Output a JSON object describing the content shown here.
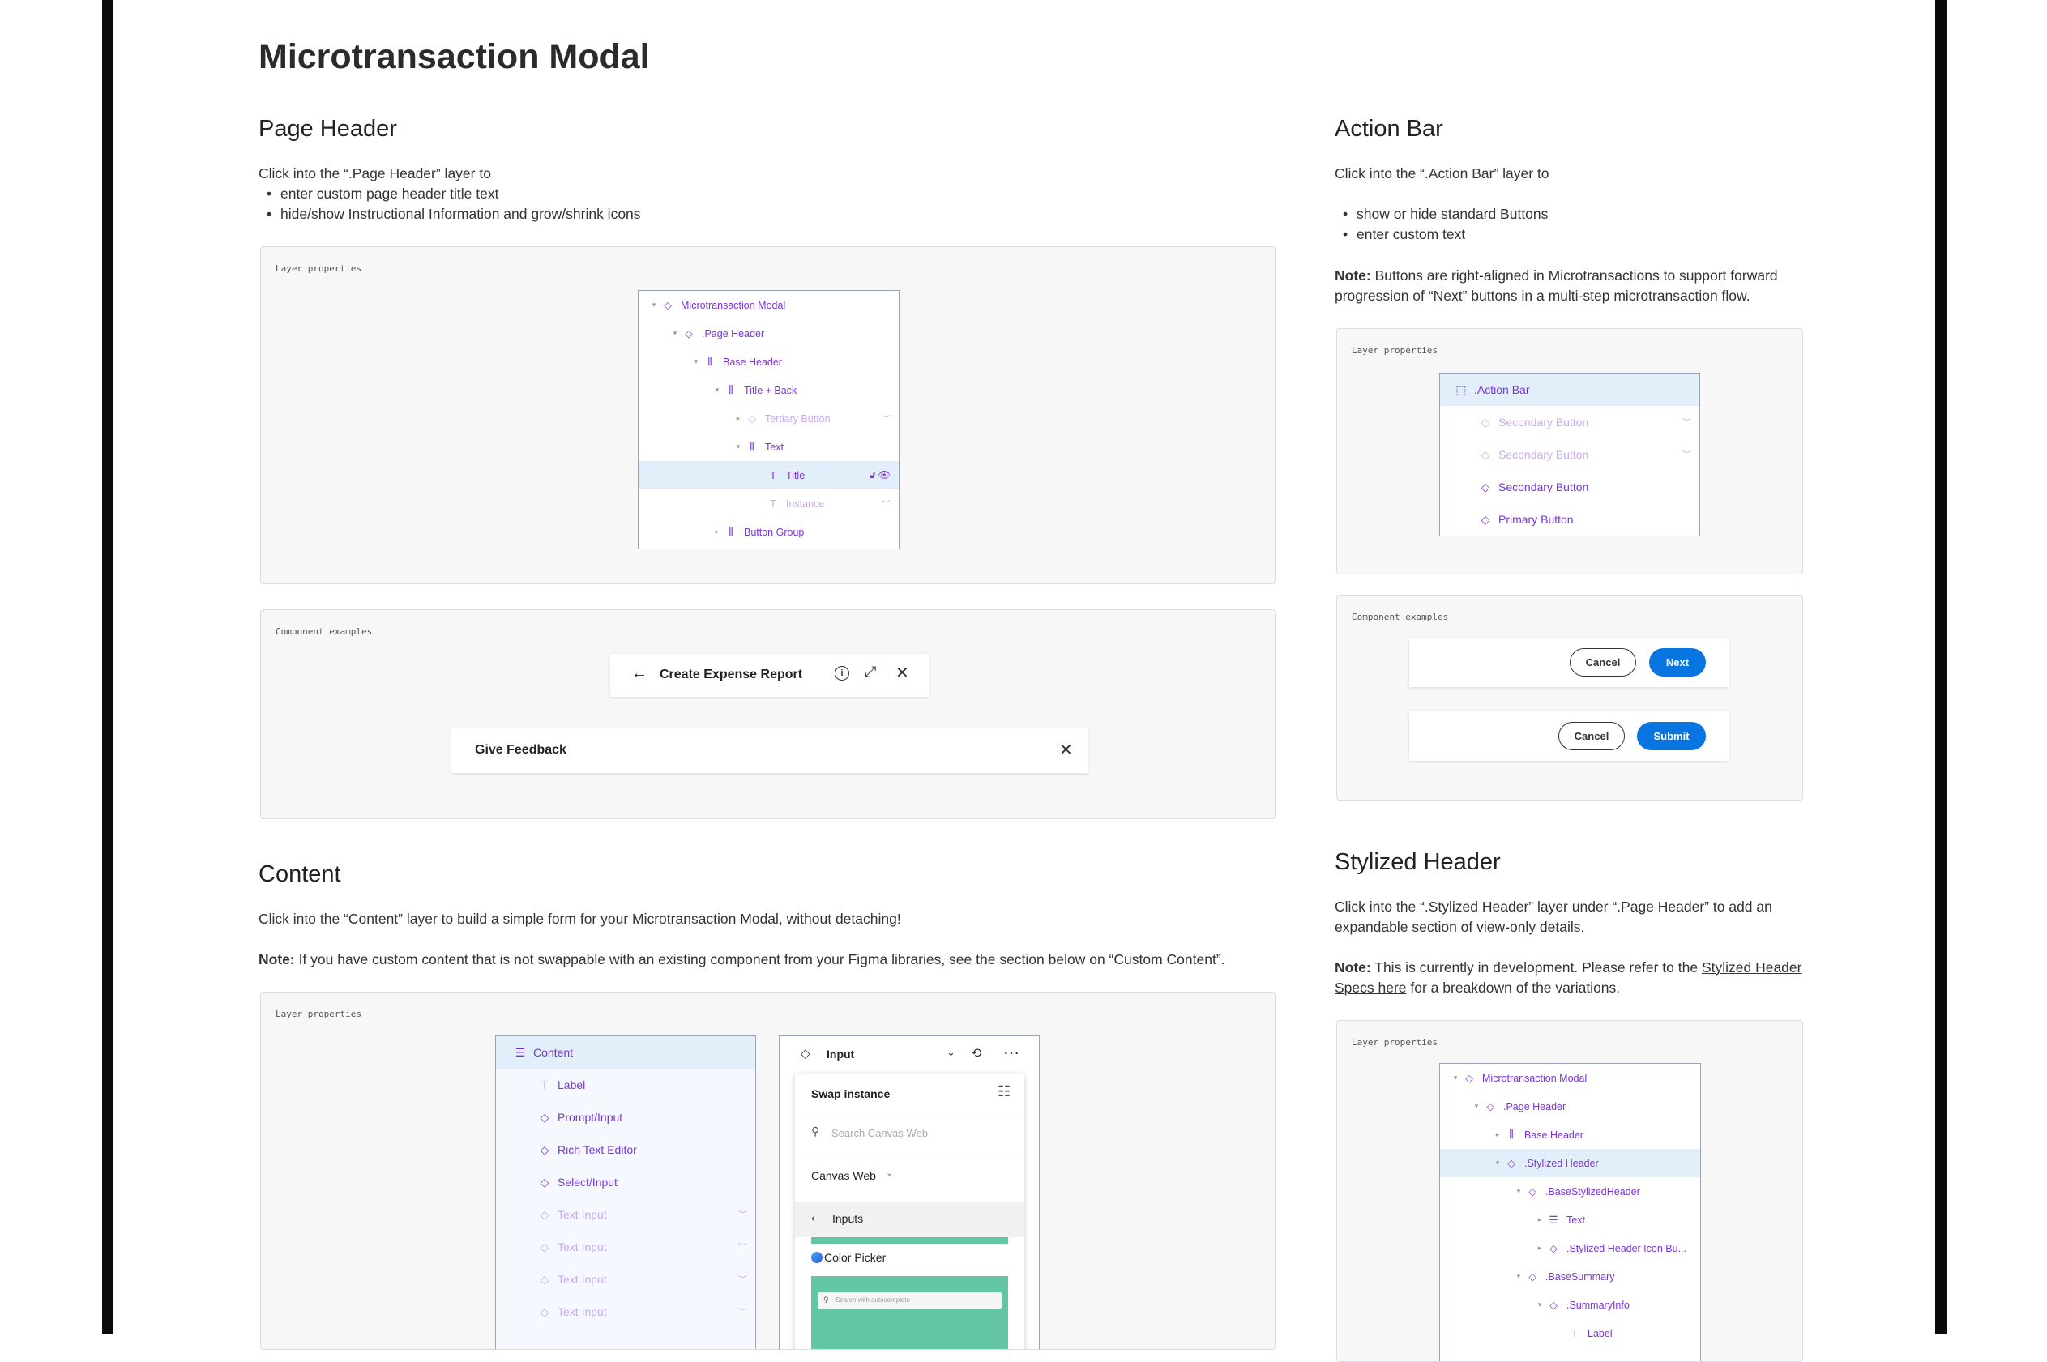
{
  "page_title": "Microtransaction Modal",
  "page_header": {
    "heading": "Page Header",
    "intro": "Click into the “.Page Header” layer to",
    "bullets": [
      "enter custom page header title text",
      "hide/show Instructional Information and grow/shrink icons"
    ],
    "layer_label": "Layer properties",
    "layers": [
      {
        "label": "Microtransaction Modal",
        "icon": "diamond-icon"
      },
      {
        "label": ".Page Header",
        "icon": "diamond-icon"
      },
      {
        "label": "Base Header",
        "icon": "auto-layout-icon"
      },
      {
        "label": "Title + Back",
        "icon": "auto-layout-icon"
      },
      {
        "label": "Tertiary Button",
        "icon": "diamond-icon"
      },
      {
        "label": "Text",
        "icon": "auto-layout-icon"
      },
      {
        "label": "Title",
        "icon": "text-icon"
      },
      {
        "label": "Instance",
        "icon": "text-icon"
      },
      {
        "label": "Button Group",
        "icon": "auto-layout-icon"
      }
    ],
    "examples_label": "Component examples",
    "example1_title": "Create Expense Report",
    "example2_title": "Give Feedback"
  },
  "action_bar": {
    "heading": "Action Bar",
    "intro": "Click into the “.Action Bar” layer to",
    "bullets": [
      "show or hide standard Buttons",
      "enter custom text"
    ],
    "note_label": "Note:",
    "note": " Buttons are right-aligned in Microtransactions to support forward progression of “Next” buttons in a multi-step microtransaction flow.",
    "layer_label": "Layer properties",
    "layers": [
      {
        "label": ".Action Bar"
      },
      {
        "label": "Secondary Button"
      },
      {
        "label": "Secondary Button"
      },
      {
        "label": "Secondary Button"
      },
      {
        "label": "Primary Button"
      }
    ],
    "examples_label": "Component examples",
    "cancel": "Cancel",
    "next": "Next",
    "submit": "Submit"
  },
  "content": {
    "heading": "Content",
    "intro": "Click into the “Content” layer to build a simple form for your Microtransaction Modal, without detaching!",
    "note_label": "Note:",
    "note": " If you have custom content that is not swappable with an existing component from your Figma libraries, see the section below on “Custom Content”.",
    "layer_label": "Layer properties",
    "layers": [
      {
        "label": "Content"
      },
      {
        "label": "Label"
      },
      {
        "label": "Prompt/Input"
      },
      {
        "label": "Rich Text Editor"
      },
      {
        "label": "Select/Input"
      },
      {
        "label": "Text Input"
      },
      {
        "label": "Text Input"
      },
      {
        "label": "Text Input"
      },
      {
        "label": "Text Input"
      }
    ],
    "instance_name": "Input",
    "swap_instance": "Swap instance",
    "search_placeholder": "Search Canvas Web",
    "library": "Canvas Web",
    "folder": "Inputs",
    "color_picker": "Color Picker",
    "autocomplete_placeholder": "Search with autocomplete"
  },
  "stylized_header": {
    "heading": "Stylized Header",
    "intro": "Click into the “.Stylized Header” layer under “.Page Header” to add an expandable section of view-only details.",
    "note_label": "Note:",
    "note_pre": " This is currently in development. Please refer to the ",
    "note_link": "Stylized Header Specs here",
    "note_post": " for a breakdown of the variations.",
    "layer_label": "Layer properties",
    "layers": [
      {
        "label": "Microtransaction Modal"
      },
      {
        "label": ".Page Header"
      },
      {
        "label": "Base Header"
      },
      {
        "label": ".Stylized Header"
      },
      {
        "label": ".BaseStylizedHeader"
      },
      {
        "label": "Text"
      },
      {
        "label": ".Stylized Header Icon Bu..."
      },
      {
        "label": ".BaseSummary"
      },
      {
        "label": ".SummaryInfo"
      },
      {
        "label": "Label"
      }
    ]
  },
  "colors": {
    "accent": "#7b34d6",
    "primary_button": "#0875e1",
    "selected_row": "#e3eefb"
  }
}
